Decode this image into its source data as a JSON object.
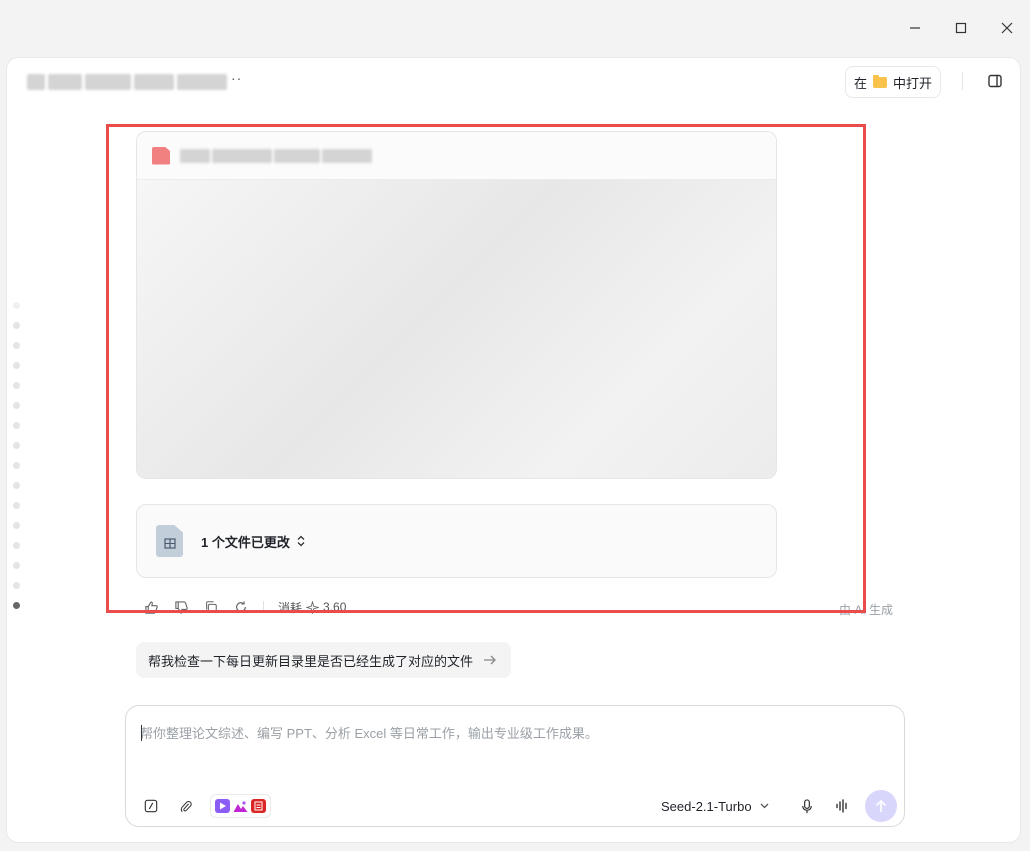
{
  "topbar": {
    "more_label": "··",
    "open_in_prefix": "在",
    "open_in_suffix": "中打开"
  },
  "changes": {
    "label": "1 个文件已更改"
  },
  "actions": {
    "consume_label": "消耗",
    "consume_value": "3.60",
    "ai_generated": "由 AI 生成"
  },
  "suggestion": {
    "text": "帮我检查一下每日更新目录里是否已经生成了对应的文件"
  },
  "composer": {
    "placeholder": "帮你整理论文综述、编写 PPT、分析 Excel 等日常工作，输出专业级工作成果。",
    "model": "Seed-2.1-Turbo"
  },
  "colors": {
    "highlight": "#ea4c4c",
    "send_button": "#d8d6fb",
    "folder": "#f8c24b"
  }
}
